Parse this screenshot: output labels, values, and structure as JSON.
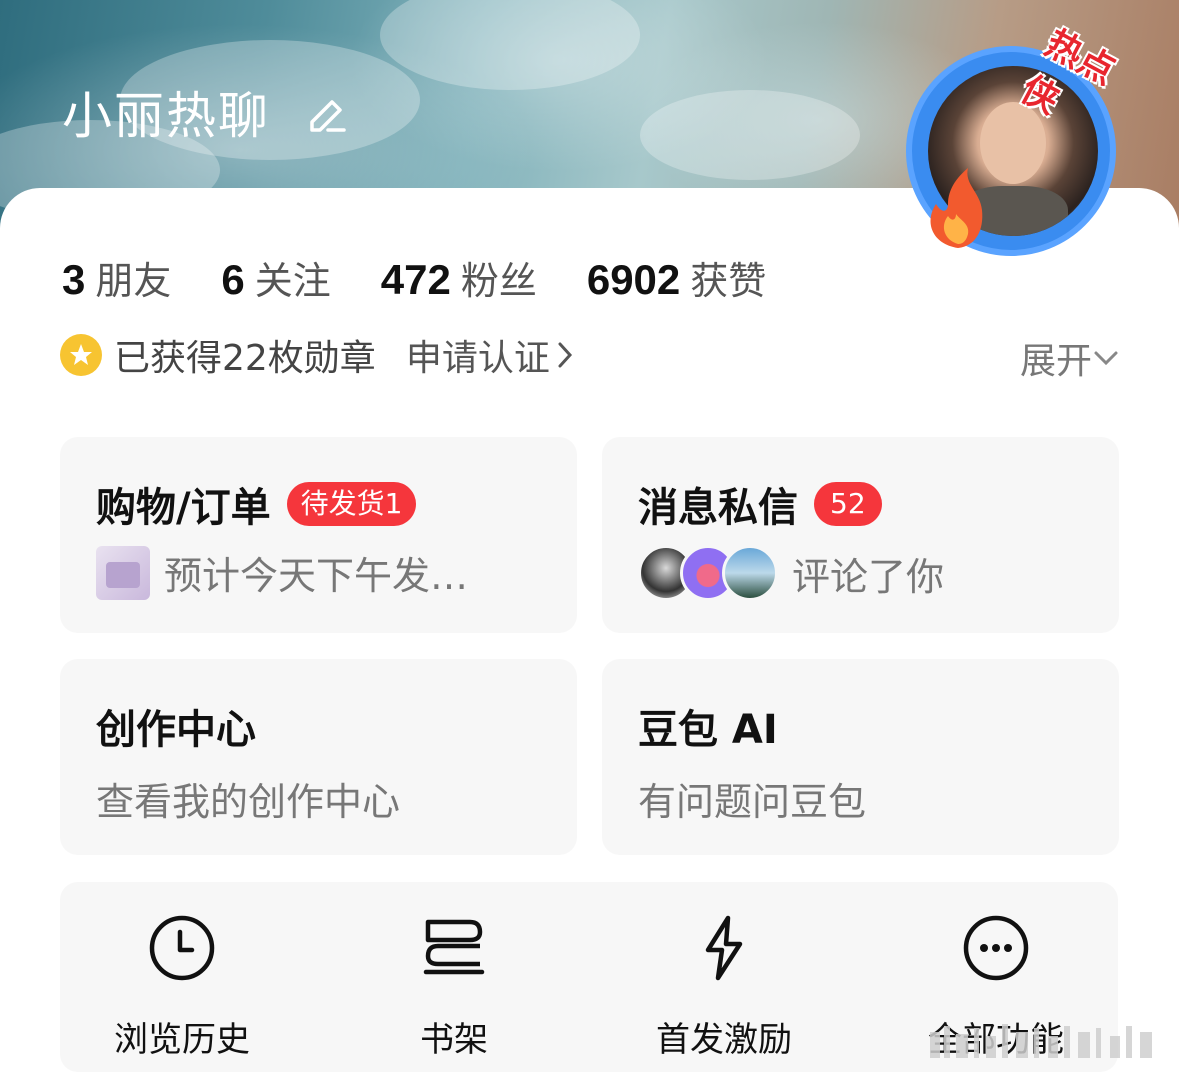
{
  "profile": {
    "name": "小丽热聊",
    "avatar_badge": "热点侠"
  },
  "stats": [
    {
      "num": "3",
      "label": "朋友"
    },
    {
      "num": "6",
      "label": "关注"
    },
    {
      "num": "472",
      "label": "粉丝"
    },
    {
      "num": "6902",
      "label": "获赞"
    }
  ],
  "badges": {
    "text": "已获得22枚勋章",
    "verify": "申请认证",
    "expand": "展开"
  },
  "tiles": {
    "shopping": {
      "title": "购物/订单",
      "pill": "待发货1",
      "sub": "预计今天下午发…"
    },
    "messages": {
      "title": "消息私信",
      "pill": "52",
      "sub": "评论了你"
    },
    "creator": {
      "title": "创作中心",
      "sub": "查看我的创作中心"
    },
    "doubao": {
      "title": "豆包 AI",
      "sub": "有问题问豆包"
    }
  },
  "tools": [
    {
      "label": "浏览历史",
      "icon": "clock-icon"
    },
    {
      "label": "书架",
      "icon": "bookshelf-icon"
    },
    {
      "label": "首发激励",
      "icon": "lightning-icon"
    },
    {
      "label": "全部功能",
      "icon": "more-icon"
    }
  ],
  "colors": {
    "accent_red": "#f5363c",
    "medal": "#f7c431",
    "tile_bg": "#f7f7f7"
  }
}
